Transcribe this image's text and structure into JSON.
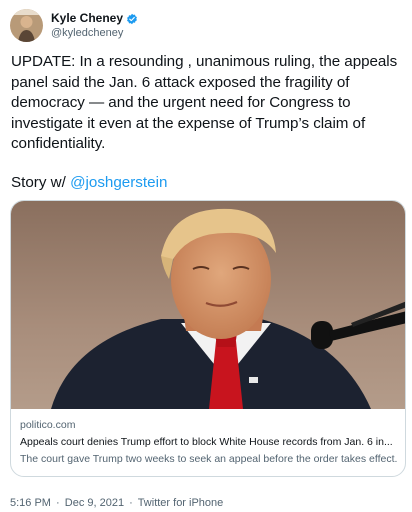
{
  "author": {
    "display_name": "Kyle Cheney",
    "handle": "@kyledcheney",
    "verified_icon": "verified-badge-icon"
  },
  "tweet": {
    "text": "UPDATE: In a resounding , unanimous ruling, the appeals panel said the Jan. 6 attack exposed the fragility of democracy — and the urgent need for Congress to investigate it even at the expense of Trump’s claim of confidentiality.",
    "story_prefix": "Story w/ ",
    "story_mention": "@joshgerstein"
  },
  "card": {
    "domain": "politico.com",
    "title": "Appeals court denies Trump effort to block White House records from Jan. 6 in...",
    "description": "The court gave Trump two weeks to seek an appeal before the order takes effect."
  },
  "meta": {
    "time": "5:16 PM",
    "separator1": "·",
    "date": "Dec 9, 2021",
    "separator2": "·",
    "source": "Twitter for iPhone"
  },
  "colors": {
    "link": "#1d9bf0",
    "secondary_text": "#536471",
    "border": "#cfd9de"
  }
}
